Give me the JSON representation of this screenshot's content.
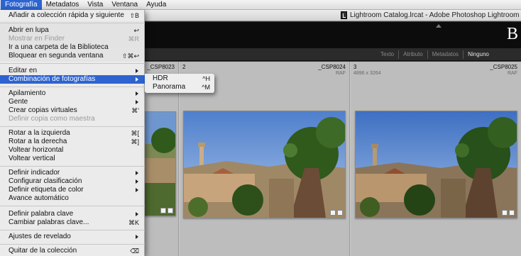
{
  "menubar": {
    "items": [
      "Fotografía",
      "Metadatos",
      "Vista",
      "Ventana",
      "Ayuda"
    ],
    "active": "Fotografía"
  },
  "window": {
    "title": "Lightroom Catalog.lrcat - Adobe Photoshop Lightroom - Bibli",
    "identity_plate": "B"
  },
  "filter_bar": {
    "options": [
      "Texto",
      "Atributo",
      "Metadatos",
      "Ninguno"
    ],
    "active": "Ninguno"
  },
  "menu": {
    "items": [
      {
        "label": "Añadir a colección rápida y siguiente",
        "shortcut": "⇧B"
      },
      {
        "label": "Abrir en lupa",
        "shortcut": "↩"
      },
      {
        "label": "Mostrar en Finder",
        "shortcut": "⌘R",
        "disabled": true
      },
      {
        "label": "Ir a una carpeta de la Biblioteca",
        "shortcut": ""
      },
      {
        "label": "Bloquear en segunda ventana",
        "shortcut": "⇧⌘↩"
      },
      {
        "label": "Editar en",
        "shortcut": ""
      },
      {
        "label": "Combinación de fotografías",
        "shortcut": ""
      },
      {
        "label": "Apilamiento",
        "shortcut": ""
      },
      {
        "label": "Gente",
        "shortcut": ""
      },
      {
        "label": "Crear copias virtuales",
        "shortcut": "⌘'"
      },
      {
        "label": "Definir copia como maestra",
        "shortcut": "",
        "disabled": true
      },
      {
        "label": "Rotar a la izquierda",
        "shortcut": "⌘["
      },
      {
        "label": "Rotar a la derecha",
        "shortcut": "⌘]"
      },
      {
        "label": "Voltear horizontal",
        "shortcut": ""
      },
      {
        "label": "Voltear vertical",
        "shortcut": ""
      },
      {
        "label": "Definir indicador",
        "shortcut": ""
      },
      {
        "label": "Configurar clasificación",
        "shortcut": ""
      },
      {
        "label": "Definir etiqueta de color",
        "shortcut": ""
      },
      {
        "label": "Avance automático",
        "shortcut": ""
      },
      {
        "label": "Definir palabra clave",
        "shortcut": ""
      },
      {
        "label": "Cambiar palabras clave...",
        "shortcut": "⌘K"
      },
      {
        "label": "Ajustes de revelado",
        "shortcut": ""
      },
      {
        "label": "Quitar de la colección",
        "shortcut": "⌫"
      }
    ]
  },
  "submenu": {
    "items": [
      {
        "label": "HDR",
        "shortcut": "^H"
      },
      {
        "label": "Panorama",
        "shortcut": "^M"
      }
    ]
  },
  "grid": {
    "cells": [
      {
        "number": "",
        "filename": "_CSP8023",
        "type": "",
        "dims": ""
      },
      {
        "number": "2",
        "filename": "_CSP8024",
        "type": "RAF",
        "dims": ""
      },
      {
        "number": "3",
        "filename": "_CSP8025",
        "type": "RAF",
        "dims": "4896 x 3264"
      }
    ]
  },
  "colors": {
    "accent": "#2e64d0",
    "sky": "#6e95cf"
  }
}
